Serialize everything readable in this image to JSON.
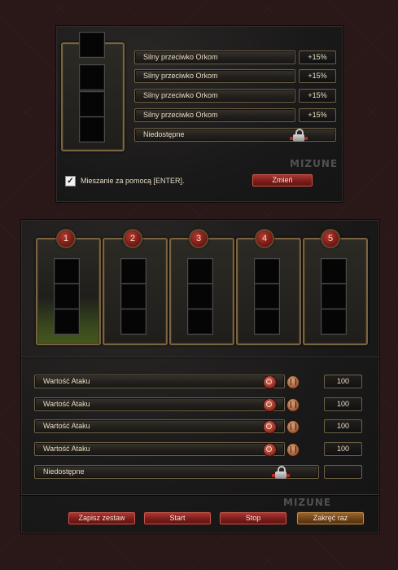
{
  "top_panel": {
    "bonuses": [
      {
        "label": "Silny przeciwko Orkom",
        "value": "+15%"
      },
      {
        "label": "Silny przeciwko Orkom",
        "value": "+15%"
      },
      {
        "label": "Silny przeciwko Orkom",
        "value": "+15%"
      },
      {
        "label": "Silny przeciwko Orkom",
        "value": "+15%"
      }
    ],
    "locked_label": "Niedostępne",
    "mix_checkbox_label": "Mieszanie za pomocą [ENTER].",
    "mix_checked": true,
    "checkmark": "✓",
    "change_button": "Zmień",
    "watermark": "MIZUNE"
  },
  "bottom_panel": {
    "sets": [
      {
        "number": "1",
        "active": true
      },
      {
        "number": "2",
        "active": false
      },
      {
        "number": "3",
        "active": false
      },
      {
        "number": "4",
        "active": false
      },
      {
        "number": "5",
        "active": false
      }
    ],
    "attack_rows": [
      {
        "label": "Wartość Ataku",
        "value": "100"
      },
      {
        "label": "Wartość Ataku",
        "value": "100"
      },
      {
        "label": "Wartość Ataku",
        "value": "100"
      },
      {
        "label": "Wartość Ataku",
        "value": "100"
      }
    ],
    "locked_label": "Niedostępne",
    "buttons": {
      "save": "Zapisz zestaw",
      "start": "Start",
      "stop": "Stop",
      "spin_once": "Zakręć raz"
    },
    "watermark": "MIZUNE"
  },
  "colors": {
    "accent_red": "#9a2a24",
    "frame_gold": "#7a6440",
    "active_green": "#44581d"
  },
  "icons": {
    "lock": "lock-icon",
    "zoom": "zoom-icon",
    "trash": "trash-icon",
    "check": "check-icon"
  }
}
